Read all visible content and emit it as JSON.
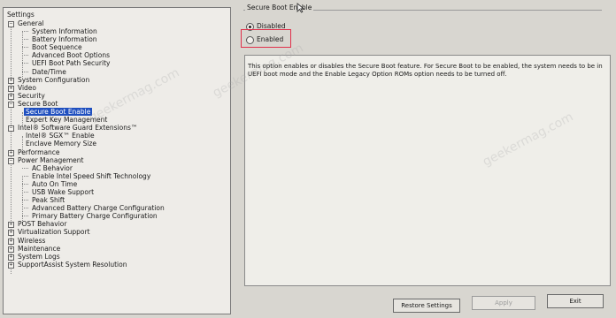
{
  "left_panel": {
    "title": "Settings",
    "tree": [
      {
        "label": "General",
        "level": 0,
        "expander": "−"
      },
      {
        "label": "System Information",
        "level": 2
      },
      {
        "label": "Battery Information",
        "level": 2
      },
      {
        "label": "Boot Sequence",
        "level": 2
      },
      {
        "label": "Advanced Boot Options",
        "level": 2
      },
      {
        "label": "UEFI Boot Path Security",
        "level": 2
      },
      {
        "label": "Date/Time",
        "level": 2
      },
      {
        "label": "System Configuration",
        "level": 0,
        "expander": "+"
      },
      {
        "label": "Video",
        "level": 0,
        "expander": "+"
      },
      {
        "label": "Security",
        "level": 0,
        "expander": "+"
      },
      {
        "label": "Secure Boot",
        "level": 0,
        "expander": "−"
      },
      {
        "label": "Secure Boot Enable",
        "level": 1,
        "selected": true
      },
      {
        "label": "Expert Key Management",
        "level": 1
      },
      {
        "label": "Intel® Software Guard Extensions™",
        "level": 0,
        "expander": "−"
      },
      {
        "label": "Intel® SGX™ Enable",
        "level": 1
      },
      {
        "label": "Enclave Memory Size",
        "level": 1
      },
      {
        "label": "Performance",
        "level": 0,
        "expander": "+"
      },
      {
        "label": "Power Management",
        "level": 0,
        "expander": "−"
      },
      {
        "label": "AC Behavior",
        "level": 2
      },
      {
        "label": "Enable Intel Speed Shift Technology",
        "level": 2
      },
      {
        "label": "Auto On Time",
        "level": 2
      },
      {
        "label": "USB Wake Support",
        "level": 2
      },
      {
        "label": "Peak Shift",
        "level": 2
      },
      {
        "label": "Advanced Battery Charge Configuration",
        "level": 2
      },
      {
        "label": "Primary Battery Charge Configuration",
        "level": 2
      },
      {
        "label": "POST Behavior",
        "level": 0,
        "expander": "+"
      },
      {
        "label": "Virtualization Support",
        "level": 0,
        "expander": "+"
      },
      {
        "label": "Wireless",
        "level": 0,
        "expander": "+"
      },
      {
        "label": "Maintenance",
        "level": 0,
        "expander": "+"
      },
      {
        "label": "System Logs",
        "level": 0,
        "expander": "+"
      },
      {
        "label": "SupportAssist System Resolution",
        "level": 0,
        "expander": "+"
      }
    ]
  },
  "right_panel": {
    "group_title": "Secure Boot Enable",
    "options": [
      {
        "label": "Disabled",
        "checked": true
      },
      {
        "label": "Enabled",
        "checked": false
      }
    ],
    "description": "This option enables or disables the Secure Boot feature. For Secure Boot to be enabled, the system needs to be in UEFI boot mode and the Enable Legacy Option ROMs option needs to be turned off."
  },
  "buttons": {
    "restore": "Restore Settings",
    "apply": "Apply",
    "exit": "Exit"
  },
  "watermarks": [
    "geekermag.com",
    "geekermag.com",
    "geekermag.com"
  ],
  "colors": {
    "selection": "#1f4fbf",
    "highlight_box": "#e0304a"
  },
  "icons": {
    "cursor": "mouse-pointer-icon"
  }
}
